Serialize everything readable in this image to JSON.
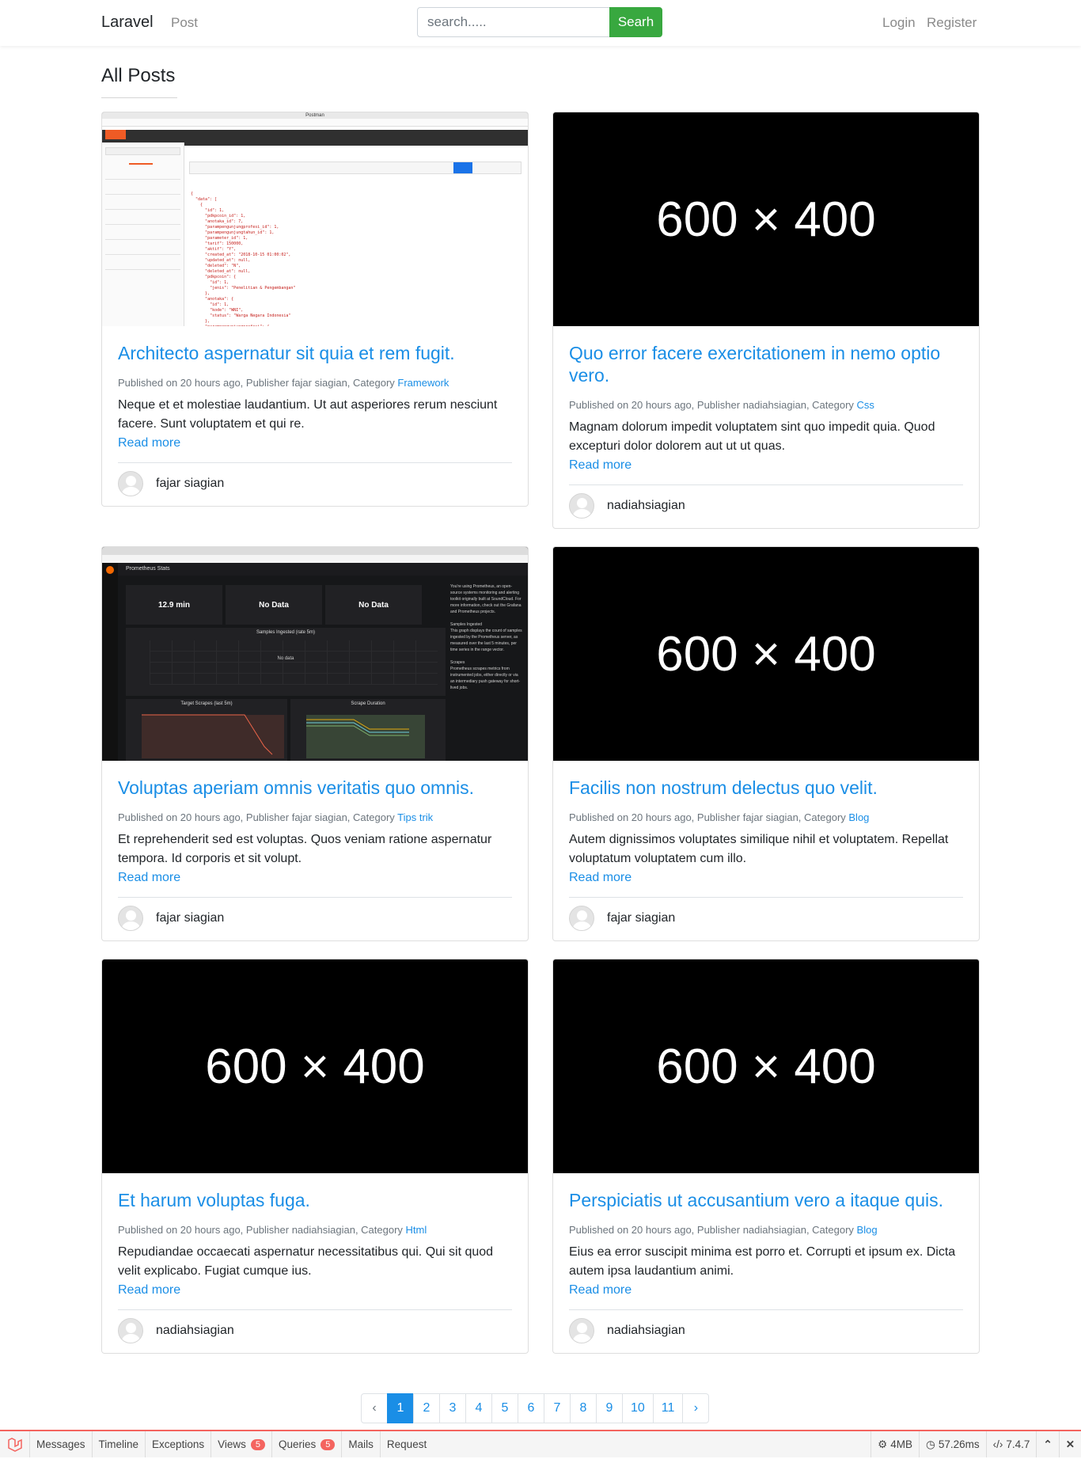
{
  "nav": {
    "brand": "Laravel",
    "post_link": "Post",
    "search_placeholder": "search.....",
    "search_button": "Searh",
    "login": "Login",
    "register": "Register"
  },
  "page_title": "All Posts",
  "posts": [
    {
      "image": "Postman screenshot",
      "title": "Architecto aspernatur sit quia et rem fugit.",
      "published": "Published on 20 hours ago, Publisher fajar siagian, Category ",
      "category": "Framework",
      "excerpt": "Neque et et molestiae laudantium. Ut aut asperiores rerum nesciunt facere. Sunt voluptatem et qui re.",
      "read_more": "Read more",
      "author": "fajar siagian"
    },
    {
      "image": "600 × 400",
      "title": "Quo error facere exercitationem in nemo optio vero.",
      "published": "Published on 20 hours ago, Publisher nadiahsiagian, Category ",
      "category": "Css",
      "excerpt": "Magnam dolorum impedit voluptatem sint quo impedit quia. Quod excepturi dolor dolorem aut ut ut quas.",
      "read_more": "Read more",
      "author": "nadiahsiagian"
    },
    {
      "image": "Grafana Prometheus Stats screenshot",
      "title": "Voluptas aperiam omnis veritatis quo omnis.",
      "published": "Published on 20 hours ago, Publisher fajar siagian, Category ",
      "category": "Tips trik",
      "excerpt": "Et reprehenderit sed est voluptas. Quos veniam ratione aspernatur tempora. Id corporis et sit volupt.",
      "read_more": "Read more",
      "author": "fajar siagian"
    },
    {
      "image": "600 × 400",
      "title": "Facilis non nostrum delectus quo velit.",
      "published": "Published on 20 hours ago, Publisher fajar siagian, Category ",
      "category": "Blog",
      "excerpt": "Autem dignissimos voluptates similique nihil et voluptatem. Repellat voluptatum voluptatem cum illo.",
      "read_more": "Read more",
      "author": "fajar siagian"
    },
    {
      "image": "600 × 400",
      "title": "Et harum voluptas fuga.",
      "published": "Published on 20 hours ago, Publisher nadiahsiagian, Category ",
      "category": "Html",
      "excerpt": "Repudiandae occaecati aspernatur necessitatibus qui. Qui sit quod velit explicabo. Fugiat cumque ius.",
      "read_more": "Read more",
      "author": "nadiahsiagian"
    },
    {
      "image": "600 × 400",
      "title": "Perspiciatis ut accusantium vero a itaque quis.",
      "published": "Published on 20 hours ago, Publisher nadiahsiagian, Category ",
      "category": "Blog",
      "excerpt": "Eius ea error suscipit minima est porro et. Corrupti et ipsum ex. Dicta autem ipsa laudantium animi.",
      "read_more": "Read more",
      "author": "nadiahsiagian"
    }
  ],
  "screenshots": {
    "postman_title": "Postman",
    "grafana_stat_1": "12.9 min",
    "grafana_stat_2": "No Data",
    "grafana_stat_3": "No Data",
    "grafana_panel_1": "Samples Ingested (rate 5m)",
    "grafana_panel_2": "Target Scrapes (last 5m)",
    "grafana_panel_3": "Scrape Duration",
    "grafana_nodata": "No data",
    "grafana_title": "Prometheus Stats"
  },
  "pagination": {
    "prev": "‹",
    "pages": [
      "1",
      "2",
      "3",
      "4",
      "5",
      "6",
      "7",
      "8",
      "9",
      "10",
      "11"
    ],
    "active": "1",
    "next": "›"
  },
  "debugbar": {
    "tabs": [
      "Messages",
      "Timeline",
      "Exceptions",
      "Views",
      "Queries",
      "Mails",
      "Request"
    ],
    "views_count": "5",
    "queries_count": "5",
    "memory": "4MB",
    "time": "57.26ms",
    "php": "7.4.7",
    "accent": "#f4645f"
  },
  "colors": {
    "link": "#1a8ee6",
    "search_button": "#38a83f"
  }
}
